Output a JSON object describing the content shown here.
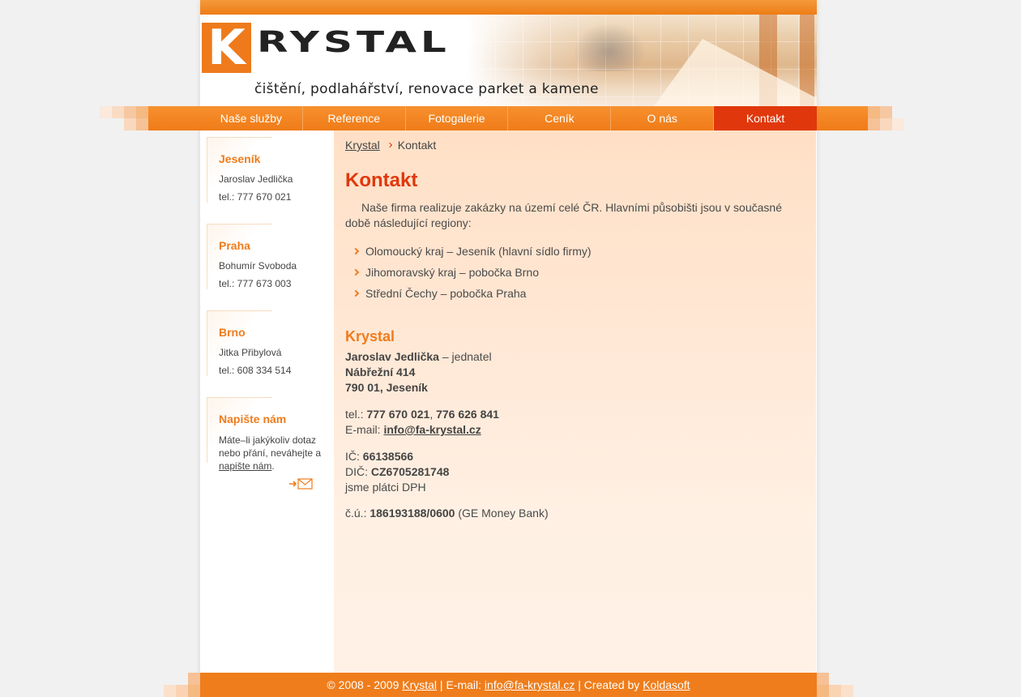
{
  "brand": {
    "logo_letter": "K",
    "logo_rest": "RYSTAL",
    "tagline": "čištění, podlahářství, renovace parket a kamene",
    "accent_color": "#ef7c1d",
    "active_color": "#e0380c"
  },
  "nav": {
    "items": [
      {
        "label": "Naše služby"
      },
      {
        "label": "Reference"
      },
      {
        "label": "Fotogalerie"
      },
      {
        "label": "Ceník"
      },
      {
        "label": "O nás"
      },
      {
        "label": "Kontakt",
        "active": true
      }
    ]
  },
  "sidebar": {
    "blocks": [
      {
        "title": "Jeseník",
        "name": "Jaroslav Jedlička",
        "phone": "tel.: 777 670 021"
      },
      {
        "title": "Praha",
        "name": "Bohumír Svoboda",
        "phone": "tel.: 777 673 003"
      },
      {
        "title": "Brno",
        "name": "Jitka Přibylová",
        "phone": "tel.: 608 334 514"
      }
    ],
    "write": {
      "title": "Napište nám",
      "text_before": "Máte–li jakýkoliv dotaz nebo přání, neváhejte a ",
      "link": "napište nám",
      "text_after": ".",
      "icon": "mail-arrow-icon"
    }
  },
  "breadcrumb": {
    "home": "Krystal",
    "current": "Kontakt"
  },
  "main": {
    "title": "Kontakt",
    "intro": "Naše firma realizuje zakázky na území celé ČR. Hlavními působišti jsou v současné době následující regiony:",
    "regions": [
      "Olomoucký kraj – Jeseník (hlavní sídlo firmy)",
      "Jihomoravský kraj – pobočka Brno",
      "Střední Čechy – pobočka Praha"
    ],
    "company_heading": "Krystal",
    "person": "Jaroslav Jedlička",
    "person_role": " – jednatel",
    "street": "Nábřežní 414",
    "city": "790 01, Jeseník",
    "tel_label": "tel.: ",
    "tel1": "777 670 021",
    "tel_sep": ", ",
    "tel2": "776 626 841",
    "email_label": "E-mail: ",
    "email": "info@fa-krystal.cz",
    "ic_label": "IČ: ",
    "ic": "66138566",
    "dic_label": "DIČ: ",
    "dic": "CZ6705281748",
    "vat_note": "jsme plátci DPH",
    "account_label": "č.ú.: ",
    "account": "186193188/0600",
    "bank": " (GE Money Bank)"
  },
  "footer": {
    "copy": "© 2008 - 2009 ",
    "brand_link": "Krystal",
    "email_label": " | E-mail: ",
    "email": "info@fa-krystal.cz",
    "created_label": " | Created by ",
    "creator": "Koldasoft"
  }
}
